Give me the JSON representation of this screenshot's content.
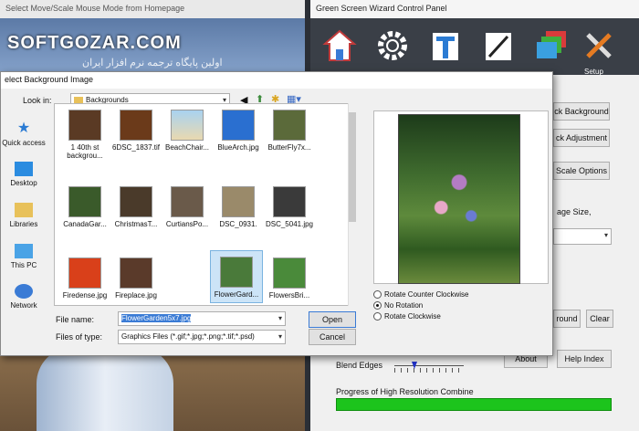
{
  "left_app": {
    "title": "Select Move/Scale Mouse Mode from Homepage",
    "watermark": "SOFTGOZAR.COM",
    "watermark_sub": "اولین پایگاه ترجمه نرم افزار ایران"
  },
  "control_panel": {
    "title": "Green Screen Wizard Control Panel",
    "toolbar": [
      "home-icon",
      "gear-icon",
      "text-icon",
      "line-icon",
      "layers-icon",
      "tools-icon"
    ],
    "setup_label": "Setup",
    "buttons": {
      "pick_background": "ck Background",
      "pick_adjustment": "ck Adjustment",
      "scale_options": "Scale Options",
      "image_size": "age Size,",
      "round": "round",
      "clear": "Clear",
      "about": "About",
      "help_index": "Help Index"
    },
    "blend_edges": "Blend Edges",
    "progress_label": "Progress of High Resolution Combine",
    "progress": 1.0
  },
  "dialog": {
    "title": "elect Background Image",
    "look_in_label": "Look in:",
    "look_in_value": "Backgrounds",
    "places": [
      "Quick access",
      "Desktop",
      "Libraries",
      "This PC",
      "Network"
    ],
    "files": [
      "1 40th st backgrou...",
      "6DSC_1837.tif",
      "BeachChair...",
      "BlueArch.jpg",
      "ButterFly7x...",
      "CanadaGar...",
      "ChristmasT...",
      "CurtiansPo...",
      "DSC_0931.",
      "DSC_5041.jpg",
      "Firedense.jpg",
      "Fireplace.jpg",
      "",
      "FlowerGard...",
      "FlowersBri..."
    ],
    "file_name_label": "File name:",
    "file_name_value": "FlowerGarden5x7.jpg",
    "files_of_type_label": "Files of type:",
    "files_of_type_value": "Graphics Files (*.gif;*.jpg;*.png;*.tif;*.psd)",
    "open_button": "Open",
    "cancel_button": "Cancel",
    "rotation": {
      "ccw": "Rotate Counter Clockwise",
      "none": "No Rotation",
      "cw": "Rotate Clockwise",
      "selected": "none"
    }
  }
}
